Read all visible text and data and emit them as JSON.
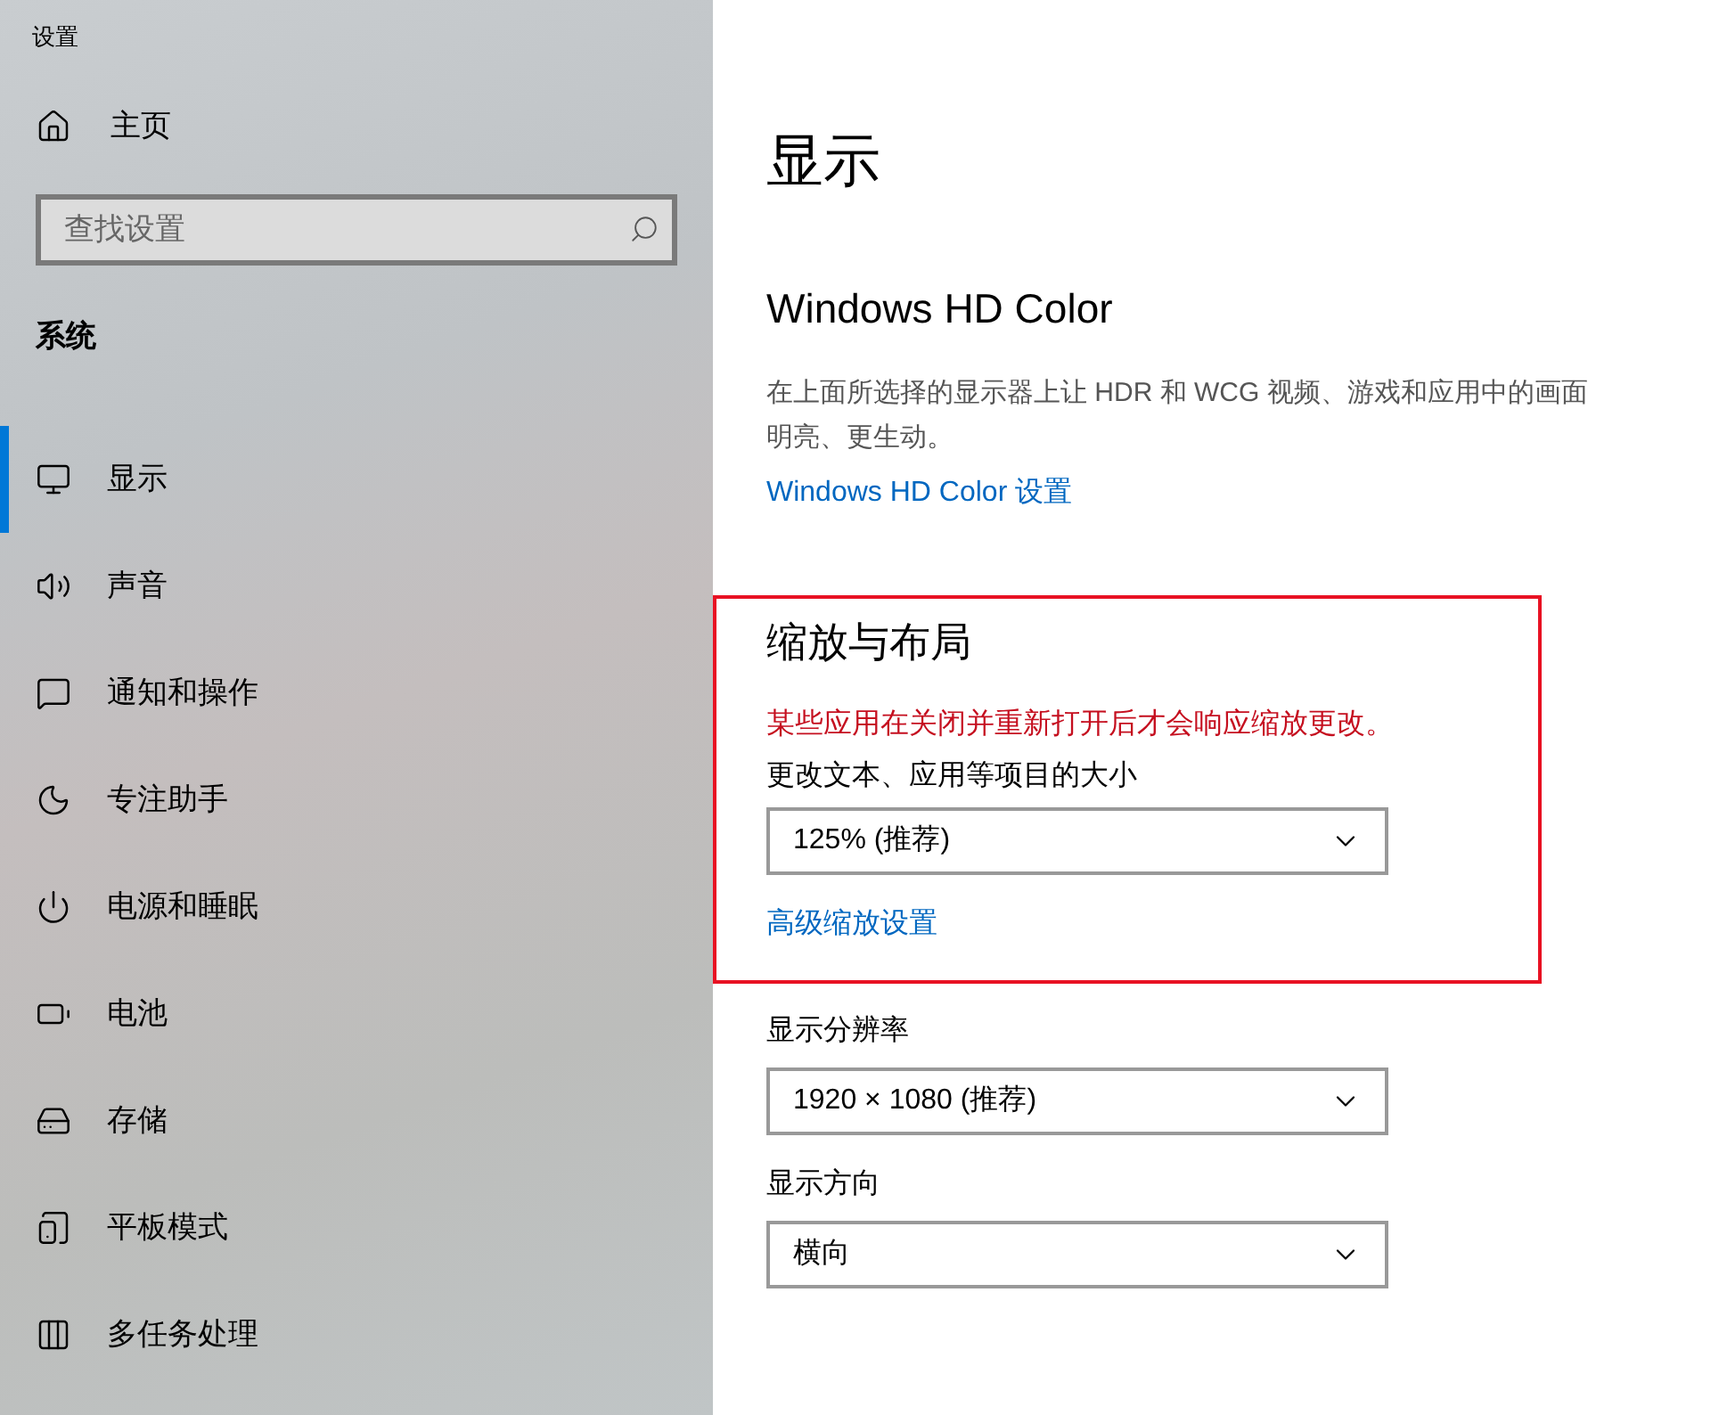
{
  "window": {
    "title": "设置"
  },
  "sidebar": {
    "home": "主页",
    "search": {
      "placeholder": "查找设置"
    },
    "section": "系统",
    "items": [
      {
        "label": "显示",
        "kind": "display",
        "selected": true
      },
      {
        "label": "声音",
        "kind": "sound",
        "selected": false
      },
      {
        "label": "通知和操作",
        "kind": "notifications",
        "selected": false
      },
      {
        "label": "专注助手",
        "kind": "focus",
        "selected": false
      },
      {
        "label": "电源和睡眠",
        "kind": "power",
        "selected": false
      },
      {
        "label": "电池",
        "kind": "battery",
        "selected": false
      },
      {
        "label": "存储",
        "kind": "storage",
        "selected": false
      },
      {
        "label": "平板模式",
        "kind": "tablet",
        "selected": false
      },
      {
        "label": "多任务处理",
        "kind": "multitask",
        "selected": false
      }
    ]
  },
  "page": {
    "title": "显示",
    "hd_color": {
      "heading": "Windows HD Color",
      "description": [
        "在上面所选择的显示器上让 HDR 和 WCG 视频、游戏和应用中的画面",
        "明亮、更生动。"
      ],
      "link": "Windows HD Color 设置"
    },
    "scale": {
      "heading": "缩放与布局",
      "warning": "某些应用在关闭并重新打开后才会响应缩放更改。",
      "label": "更改文本、应用等项目的大小",
      "value": "125% (推荐)",
      "link": "高级缩放设置"
    },
    "resolution": {
      "label": "显示分辨率",
      "value": "1920 × 1080 (推荐)"
    },
    "orientation": {
      "label": "显示方向",
      "value": "横向"
    }
  }
}
